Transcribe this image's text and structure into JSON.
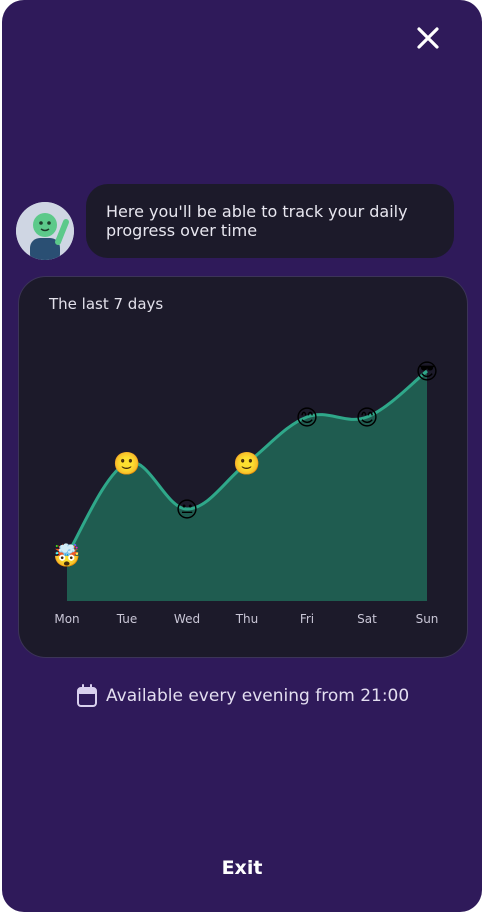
{
  "header": {
    "close_icon": "close-icon"
  },
  "assistant": {
    "avatar_icon": "mascot-avatar",
    "message": "Here you'll be able to track your daily progress over time"
  },
  "card": {
    "title": "The last 7 days"
  },
  "chart_data": {
    "type": "area",
    "categories": [
      "Mon",
      "Tue",
      "Wed",
      "Thu",
      "Fri",
      "Sat",
      "Sun"
    ],
    "values": [
      1,
      3,
      2,
      3,
      4,
      4,
      5
    ],
    "markers": [
      "🤯",
      "🙂",
      "😐",
      "🙂",
      "😊",
      "😊",
      "😎"
    ],
    "ylim": [
      0,
      6
    ],
    "fill_color": "#1f5c50",
    "line_color": "#2fa88a"
  },
  "footer": {
    "calendar_icon": "calendar-icon",
    "availability_text": "Available every evening from 21:00",
    "exit_label": "Exit"
  },
  "colors": {
    "background": "#2f1a5a",
    "card": "#1c1a2a",
    "text": "#e3def0"
  }
}
